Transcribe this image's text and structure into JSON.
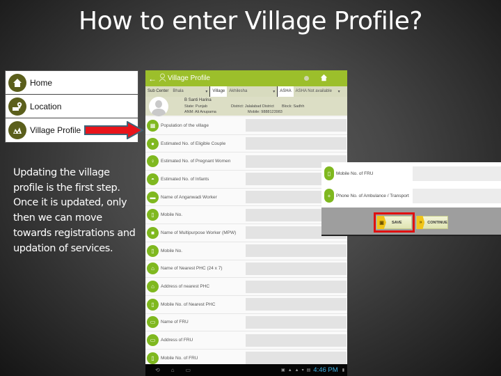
{
  "slide": {
    "title": "How to enter Village Profile?",
    "description": "Updating the village profile is the first step. Once it is updated, only then we can move towards registrations and updation of services."
  },
  "menu": {
    "items": [
      {
        "label": "Home",
        "icon": "home-icon"
      },
      {
        "label": "Location",
        "icon": "location-pin-icon"
      },
      {
        "label": "Village Profile",
        "icon": "village-icon"
      }
    ],
    "arrow_color": "#e8141b"
  },
  "app": {
    "header": {
      "back_glyph": "←",
      "title": "Village Profile",
      "home_glyph": "⌂",
      "color": "#9cbf2b"
    },
    "filters": {
      "sub_center_label": "Sub Center",
      "sub_center_value": "Bhala",
      "village_label": "Village",
      "village_value": "Akhilesha",
      "asha_label": "ASHA",
      "asha_value": "ASHA Not available"
    },
    "profile": {
      "name": "B Santi Harina",
      "state": "State: Punjab",
      "district": "District: Jalalabad District",
      "block": "Block: Sadhh",
      "anm": "ANM: Ali Anupama",
      "mobile": "Mobile: 9888123983"
    },
    "fields": [
      {
        "label": "Population of the village",
        "icon": "population-icon",
        "value": ""
      },
      {
        "label": "Estimated No. of Eligible Couple",
        "icon": "couple-icon",
        "value": ""
      },
      {
        "label": "Estimated No. of Pregnant Women",
        "icon": "pregnant-woman-icon",
        "value": ""
      },
      {
        "label": "Estimated No. of Infants",
        "icon": "stroller-icon",
        "value": ""
      },
      {
        "label": "Name of Anganwadi Worker",
        "icon": "anganwadi-icon",
        "value": ""
      },
      {
        "label": "Mobile No.",
        "icon": "mobile-icon",
        "value": ""
      },
      {
        "label": "Name of Multipurpose Worker (MPW)",
        "icon": "worker-icon",
        "value": ""
      },
      {
        "label": "Mobile No.",
        "icon": "mobile-icon",
        "value": ""
      },
      {
        "label": "Name of Nearest PHC (24 x 7)",
        "icon": "phc-icon",
        "value": ""
      },
      {
        "label": "Address of nearest PHC",
        "icon": "phc-address-icon",
        "value": ""
      },
      {
        "label": "Mobile No. of Nearest PHC",
        "icon": "mobile-icon",
        "value": ""
      },
      {
        "label": "Name of FRU",
        "icon": "fru-bed-icon",
        "value": ""
      },
      {
        "label": "Address of FRU",
        "icon": "fru-address-icon",
        "value": ""
      },
      {
        "label": "Mobile No. of FRU",
        "icon": "mobile-icon",
        "value": ""
      }
    ],
    "navbar": {
      "back_glyph": "⟲",
      "home_glyph": "⌂",
      "recents_glyph": "▭",
      "time": "4:46 PM",
      "clock_color": "#3fb0e3"
    }
  },
  "popup": {
    "fields": [
      {
        "label": "Mobile No. of FRU",
        "icon": "mobile-icon",
        "value": ""
      },
      {
        "label": "Phone No. of Ambulance / Transport",
        "icon": "ambulance-phone-icon",
        "value": ""
      }
    ],
    "save_label": "SAVE",
    "continue_label": "CONTINUE",
    "highlight_color": "#e01010"
  }
}
